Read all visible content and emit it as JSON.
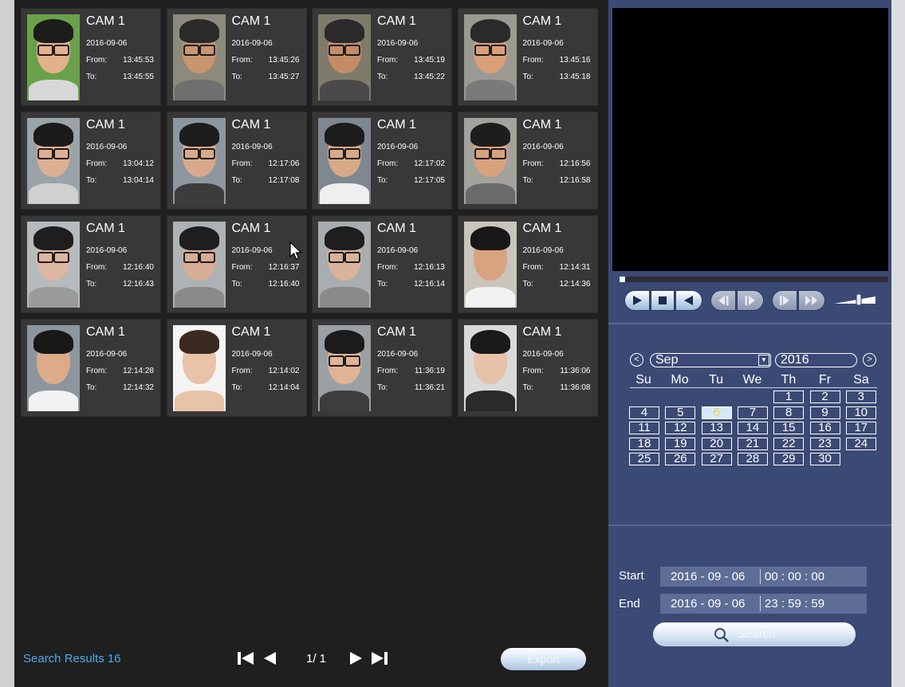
{
  "results": [
    {
      "cam": "CAM 1",
      "date": "2016-09-06",
      "from_label": "From:",
      "from": "13:45:53",
      "to_label": "To:",
      "to": "13:45:55",
      "skin": "#e3b08c",
      "hair": "#1c1c1c",
      "bg": "#6aa14a",
      "body": "#d8d8d8",
      "glasses": true
    },
    {
      "cam": "CAM 1",
      "date": "2016-09-06",
      "from_label": "From:",
      "from": "13:45:26",
      "to_label": "To:",
      "to": "13:45:27",
      "skin": "#c9956e",
      "hair": "#2a2a2a",
      "bg": "#8c8a7c",
      "body": "#6f6f6f",
      "glasses": true
    },
    {
      "cam": "CAM 1",
      "date": "2016-09-06",
      "from_label": "From:",
      "from": "13:45:19",
      "to_label": "To:",
      "to": "13:45:22",
      "skin": "#c48c66",
      "hair": "#2a2a2a",
      "bg": "#7e7b6a",
      "body": "#4a4a4a",
      "glasses": true
    },
    {
      "cam": "CAM 1",
      "date": "2016-09-06",
      "from_label": "From:",
      "from": "13:45:16",
      "to_label": "To:",
      "to": "13:45:18",
      "skin": "#d9a07a",
      "hair": "#2a2a2a",
      "bg": "#9a9a92",
      "body": "#7a7a7a",
      "glasses": true
    },
    {
      "cam": "CAM 1",
      "date": "2016-09-06",
      "from_label": "From:",
      "from": "13:04:12",
      "to_label": "To:",
      "to": "13:04:14",
      "skin": "#ddb093",
      "hair": "#1b1b1b",
      "bg": "#9aa3a8",
      "body": "#d0d0d0",
      "glasses": true
    },
    {
      "cam": "CAM 1",
      "date": "2016-09-06",
      "from_label": "From:",
      "from": "12:17:06",
      "to_label": "To:",
      "to": "12:17:08",
      "skin": "#d8aa8b",
      "hair": "#1d1d1d",
      "bg": "#8e97a0",
      "body": "#3c3c3c",
      "glasses": true
    },
    {
      "cam": "CAM 1",
      "date": "2016-09-06",
      "from_label": "From:",
      "from": "12:17:02",
      "to_label": "To:",
      "to": "12:17:05",
      "skin": "#d7a989",
      "hair": "#1d1d1d",
      "bg": "#7f8790",
      "body": "#efefef",
      "glasses": true
    },
    {
      "cam": "CAM 1",
      "date": "2016-09-06",
      "from_label": "From:",
      "from": "12:16:56",
      "to_label": "To:",
      "to": "12:16:58",
      "skin": "#d9a27e",
      "hair": "#1d1d1d",
      "bg": "#a3a29c",
      "body": "#6a6a6a",
      "glasses": true
    },
    {
      "cam": "CAM 1",
      "date": "2016-09-06",
      "from_label": "From:",
      "from": "12:16:40",
      "to_label": "To:",
      "to": "12:16:43",
      "skin": "#dcb6a0",
      "hair": "#1e1e1e",
      "bg": "#b6bbbd",
      "body": "#9a9a9a",
      "glasses": true
    },
    {
      "cam": "CAM 1",
      "date": "2016-09-06",
      "from_label": "From:",
      "from": "12:16:37",
      "to_label": "To:",
      "to": "12:16:40",
      "skin": "#d6ad95",
      "hair": "#1e1e1e",
      "bg": "#aeb2b4",
      "body": "#8a8a8a",
      "glasses": true
    },
    {
      "cam": "CAM 1",
      "date": "2016-09-06",
      "from_label": "From:",
      "from": "12:16:13",
      "to_label": "To:",
      "to": "12:16:14",
      "skin": "#d8b29a",
      "hair": "#1e1e1e",
      "bg": "#a9adaf",
      "body": "#8a8a8a",
      "glasses": true
    },
    {
      "cam": "CAM 1",
      "date": "2016-09-06",
      "from_label": "From:",
      "from": "12:14:31",
      "to_label": "To:",
      "to": "12:14:36",
      "skin": "#d9a37f",
      "hair": "#181818",
      "bg": "#c9c5bd",
      "body": "#f2f2f2",
      "glasses": false
    },
    {
      "cam": "CAM 1",
      "date": "2016-09-06",
      "from_label": "From:",
      "from": "12:14:28",
      "to_label": "To:",
      "to": "12:14:32",
      "skin": "#dcab8a",
      "hair": "#181818",
      "bg": "#8d969f",
      "body": "#f2f2f2",
      "glasses": false
    },
    {
      "cam": "CAM 1",
      "date": "2016-09-06",
      "from_label": "From:",
      "from": "12:14:02",
      "to_label": "To:",
      "to": "12:14:04",
      "skin": "#e8c3a8",
      "hair": "#3a2a20",
      "bg": "#f4f4f4",
      "body": "#e8c3a8",
      "glasses": false
    },
    {
      "cam": "CAM 1",
      "date": "2016-09-06",
      "from_label": "From:",
      "from": "11:36:19",
      "to_label": "To:",
      "to": "11:36:21",
      "skin": "#e0b396",
      "hair": "#1c1c1c",
      "bg": "#9aa0a4",
      "body": "#3d3d3d",
      "glasses": true
    },
    {
      "cam": "CAM 1",
      "date": "2016-09-06",
      "from_label": "From:",
      "from": "11:36:06",
      "to_label": "To:",
      "to": "11:36:08",
      "skin": "#e7c2a8",
      "hair": "#1a1a1a",
      "bg": "#dadada",
      "body": "#2a2a2a",
      "glasses": false
    }
  ],
  "footer": {
    "search_results_label": "Search Results",
    "search_results_count": "16",
    "page_text": "1/ 1",
    "export_label": "Export"
  },
  "player": {
    "progress": 0.02,
    "buttons": [
      "play-icon",
      "stop-icon",
      "reverse-play-icon",
      "prev-frame-icon",
      "next-frame-icon",
      "slow-play-icon",
      "fast-play-icon"
    ],
    "volume": 0.6
  },
  "calendar": {
    "month": "Sep",
    "year": "2016",
    "weekdays": [
      "Su",
      "Mo",
      "Tu",
      "We",
      "Th",
      "Fr",
      "Sa"
    ],
    "first_weekday": 4,
    "days_in_month": 30,
    "selected_day": 6
  },
  "time_range": {
    "start_label": "Start",
    "start_date": "2016 - 09 - 06",
    "start_time": "00 : 00 : 00",
    "end_label": "End",
    "end_date": "2016 - 09 - 06",
    "end_time": "23 : 59 : 59",
    "search_label": "Search"
  },
  "colors": {
    "panel_bg": "#3b4a74",
    "grid_bg": "#1f1f1f",
    "tile_bg": "#383838",
    "accent_text": "#4ba9e6",
    "selected_day_text": "#f0d34a"
  }
}
